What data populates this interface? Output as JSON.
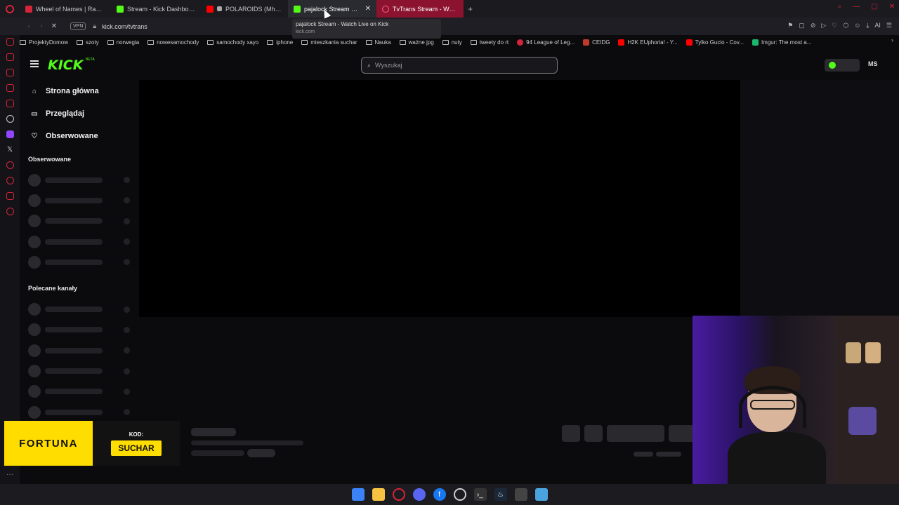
{
  "browser": {
    "tabs": [
      {
        "title": "Wheel of Names | Random",
        "color": "#d6243a"
      },
      {
        "title": "Stream - Kick Dashboard",
        "color": "#53fc18"
      },
      {
        "title": "POLAROIDS (Mhm, Mi",
        "color": "#ff0000"
      },
      {
        "title": "pajalock Stream - Wat",
        "color": "#53fc18"
      },
      {
        "title": "TvTrans Stream - Watch L",
        "color": "#d6243a"
      }
    ],
    "new_tab": "+",
    "vpn_label": "VPN",
    "url": "kick.com/tvtrans",
    "tooltip": {
      "title": "pajalock Stream - Watch Live on Kick",
      "domain": "kick.com"
    },
    "ai_label": "AI"
  },
  "bookmarks": [
    {
      "label": "ProjektyDomow",
      "type": "folder"
    },
    {
      "label": "szoty",
      "type": "folder"
    },
    {
      "label": "norwegia",
      "type": "folder"
    },
    {
      "label": "nowesamochody",
      "type": "folder"
    },
    {
      "label": "samochody xayo",
      "type": "folder"
    },
    {
      "label": "iphone",
      "type": "folder"
    },
    {
      "label": "mieszkania suchar",
      "type": "folder"
    },
    {
      "label": "Nauka",
      "type": "folder"
    },
    {
      "label": "ważne jpg",
      "type": "folder"
    },
    {
      "label": "nuty",
      "type": "folder"
    },
    {
      "label": "tweety do rt",
      "type": "folder"
    },
    {
      "label": "94 League of Leg...",
      "type": "site",
      "color": "#d6243a"
    },
    {
      "label": "CEIDG",
      "type": "site",
      "color": "#c0392b"
    },
    {
      "label": "H2K EUphoria! - Y...",
      "type": "site",
      "color": "#ff0000"
    },
    {
      "label": "Tylko Gucio - Cov...",
      "type": "site",
      "color": "#ff0000"
    },
    {
      "label": "Imgur: The most a...",
      "type": "site",
      "color": "#1bb76e"
    }
  ],
  "kick": {
    "logo": "KICK",
    "beta": "BETA",
    "search_placeholder": "Wyszukaj",
    "user_initials": "MS",
    "nav": [
      {
        "label": "Strona główna",
        "icon": "home-icon"
      },
      {
        "label": "Przeglądaj",
        "icon": "browse-icon"
      },
      {
        "label": "Obserwowane",
        "icon": "heart-icon"
      }
    ],
    "section_followed": "Obserwowane",
    "section_recommended": "Polecane kanały"
  },
  "overlay": {
    "brand": "FORTUNA",
    "code_label": "KOD:",
    "code": "SUCHAR"
  }
}
